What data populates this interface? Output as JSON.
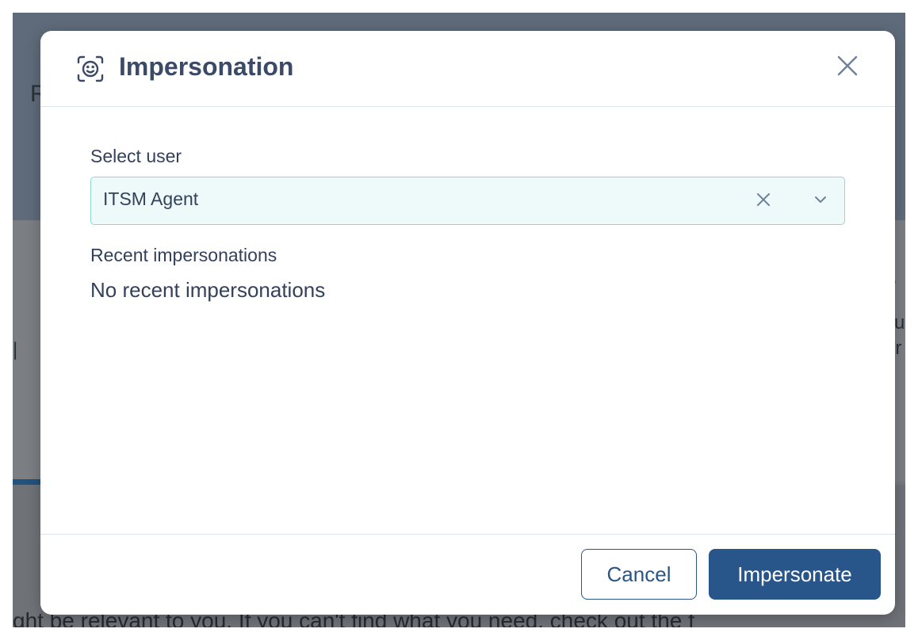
{
  "background": {
    "fragment_top_left": "R",
    "fragment_right_heading": "e",
    "fragment_right_line1": "su",
    "fragment_right_line2": "or",
    "fragment_left": "|",
    "fragment_bottom": "ght be relevant to you. If you can't find what you need, check out the f"
  },
  "modal": {
    "icon": "face-scan-icon",
    "title": "Impersonation",
    "close_icon": "close-icon",
    "field_label": "Select user",
    "selected_user": "ITSM Agent",
    "clear_icon": "clear-icon",
    "dropdown_icon": "chevron-down-icon",
    "recent_heading": "Recent impersonations",
    "recent_empty": "No recent impersonations",
    "cancel_label": "Cancel",
    "submit_label": "Impersonate"
  },
  "colors": {
    "primary": "#29568a",
    "title": "#3b4a66",
    "select_bg": "#eefafa",
    "select_border": "#8fd6d9"
  }
}
